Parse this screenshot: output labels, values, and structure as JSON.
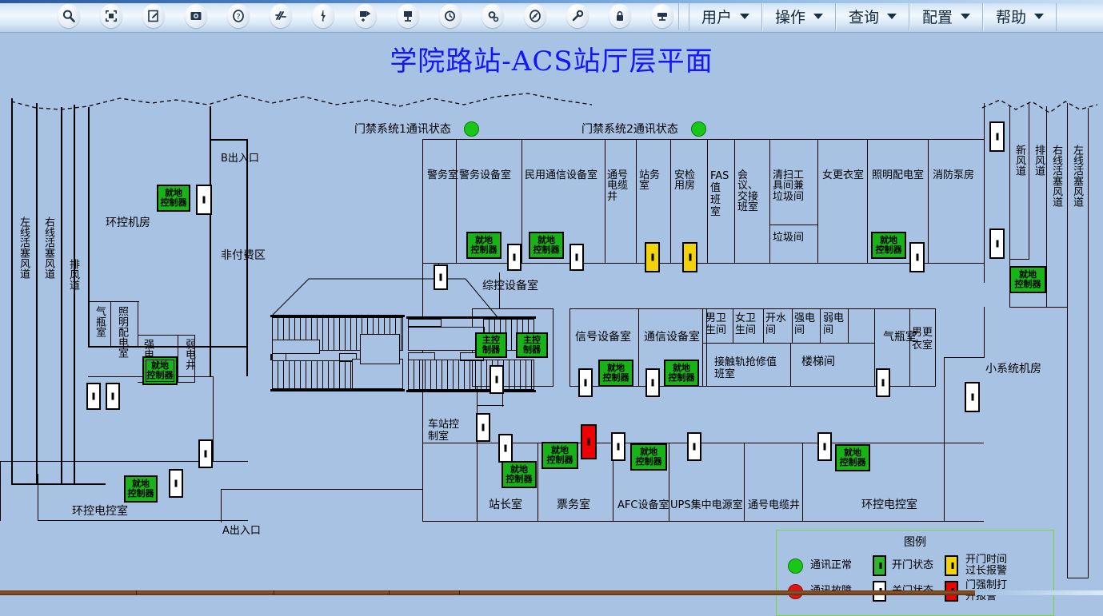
{
  "toolbar": {
    "icons": [
      {
        "name": "search-icon",
        "glyph": "search"
      },
      {
        "name": "fit-screen-icon",
        "glyph": "fit"
      },
      {
        "name": "edit-icon",
        "glyph": "edit"
      },
      {
        "name": "camera-icon",
        "glyph": "camera"
      },
      {
        "name": "help-circle-icon",
        "glyph": "question"
      },
      {
        "name": "link-broken-icon",
        "glyph": "break"
      },
      {
        "name": "lightning-icon",
        "glyph": "bolt"
      },
      {
        "name": "move-device-icon",
        "glyph": "movedev"
      },
      {
        "name": "device-icon",
        "glyph": "device"
      },
      {
        "name": "history-clock-icon",
        "glyph": "history"
      },
      {
        "name": "settings-gear-icon",
        "glyph": "gear"
      },
      {
        "name": "clock-alert-icon",
        "glyph": "clockalert"
      },
      {
        "name": "wrench-icon",
        "glyph": "wrench"
      },
      {
        "name": "lock-icon",
        "glyph": "lock"
      },
      {
        "name": "card-reader-icon",
        "glyph": "reader"
      }
    ],
    "menus": [
      {
        "label": "用户"
      },
      {
        "label": "操作"
      },
      {
        "label": "查询"
      },
      {
        "label": "配置"
      },
      {
        "label": "帮助"
      }
    ]
  },
  "page": {
    "title": "学院路站-ACS站厅层平面",
    "title_color": "#1414ff",
    "background_color": "#a8c2e3"
  },
  "status": [
    {
      "label": "门禁系统1通讯状态",
      "state": "green"
    },
    {
      "label": "门禁系统2通讯状态",
      "state": "green"
    }
  ],
  "exits": [
    {
      "label": "B出入口"
    },
    {
      "label": "A出入口"
    }
  ],
  "zones": [
    {
      "label": "非付费区"
    }
  ],
  "rooms": [
    {
      "label": "左线活塞风道",
      "orient": "vertical"
    },
    {
      "label": "右线活塞风道",
      "orient": "vertical"
    },
    {
      "label": "排风道",
      "orient": "vertical"
    },
    {
      "label": "气瓶室",
      "orient": "vertical"
    },
    {
      "label": "照明配电室",
      "orient": "vertical"
    },
    {
      "label": "强电井",
      "orient": "vertical"
    },
    {
      "label": "弱电井",
      "orient": "vertical"
    },
    {
      "label": "环控机房",
      "orient": "horizontal"
    },
    {
      "label": "环控电控室",
      "orient": "horizontal"
    },
    {
      "label": "警务室",
      "orient": "horizontal"
    },
    {
      "label": "警务设备室",
      "orient": "horizontal"
    },
    {
      "label": "民用通信设备室",
      "orient": "horizontal"
    },
    {
      "label": "通号电缆井",
      "orient": "horizontal"
    },
    {
      "label": "站务室",
      "orient": "horizontal"
    },
    {
      "label": "安检用房",
      "orient": "horizontal"
    },
    {
      "label": "FAS值班室",
      "orient": "horizontal"
    },
    {
      "label": "会议、交接班室",
      "orient": "horizontal"
    },
    {
      "label": "清扫工具间兼垃圾间",
      "orient": "horizontal"
    },
    {
      "label": "垃圾间",
      "orient": "horizontal"
    },
    {
      "label": "女更衣室",
      "orient": "horizontal"
    },
    {
      "label": "照明配电室",
      "orient": "horizontal"
    },
    {
      "label": "消防泵房",
      "orient": "horizontal"
    },
    {
      "label": "新风道",
      "orient": "vertical"
    },
    {
      "label": "排风道",
      "orient": "vertical"
    },
    {
      "label": "右线活塞风道",
      "orient": "vertical"
    },
    {
      "label": "左线活塞风道",
      "orient": "vertical"
    },
    {
      "label": "综控设备室",
      "orient": "horizontal"
    },
    {
      "label": "信号设备室",
      "orient": "horizontal"
    },
    {
      "label": "通信设备室",
      "orient": "horizontal"
    },
    {
      "label": "男卫生间",
      "orient": "horizontal"
    },
    {
      "label": "女卫生间",
      "orient": "horizontal"
    },
    {
      "label": "开水间",
      "orient": "horizontal"
    },
    {
      "label": "强电间",
      "orient": "horizontal"
    },
    {
      "label": "弱电间",
      "orient": "horizontal"
    },
    {
      "label": "接触轨抢修值班室",
      "orient": "horizontal"
    },
    {
      "label": "楼梯间",
      "orient": "horizontal"
    },
    {
      "label": "气瓶室",
      "orient": "horizontal"
    },
    {
      "label": "男更衣室",
      "orient": "horizontal"
    },
    {
      "label": "小系统机房",
      "orient": "horizontal"
    },
    {
      "label": "车站控制室",
      "orient": "horizontal"
    },
    {
      "label": "站长室",
      "orient": "horizontal"
    },
    {
      "label": "票务室",
      "orient": "horizontal"
    },
    {
      "label": "AFC设备室",
      "orient": "horizontal"
    },
    {
      "label": "UPS集中电源室",
      "orient": "horizontal"
    },
    {
      "label": "通号电缆井",
      "orient": "horizontal"
    },
    {
      "label": "环控电控室",
      "orient": "horizontal"
    }
  ],
  "room_labels": {
    "r1": "左线活塞风道",
    "r2": "右线活塞风道",
    "r3": "排风道",
    "r4": "气瓶室",
    "r5": "照明配电室",
    "r6": "强电井",
    "r7": "弱电井",
    "r8": "环控机房",
    "r9": "环控电控室",
    "r10": "警务室",
    "r11": "警务设备室",
    "r12": "民用通信设备室",
    "r13": "通号电缆井",
    "r14": "站务室",
    "r15": "安检用房",
    "r16": "FAS值班室",
    "r17": "会议、交接班室",
    "r18": "清扫工具间兼垃圾间",
    "r19": "垃圾间",
    "r20": "女更衣室",
    "r21": "照明配电室",
    "r22": "消防泵房",
    "r23": "新风道",
    "r24": "排风道",
    "r25": "右线活塞风道",
    "r26": "左线活塞风道",
    "r27": "综控设备室",
    "r28": "信号设备室",
    "r29": "通信设备室",
    "r30": "男卫生间",
    "r31": "女卫生间",
    "r32": "开水间",
    "r33": "强电间",
    "r34": "弱电间",
    "r35": "接触轨抢修值班室",
    "r36": "楼梯间",
    "r37": "气瓶室",
    "r38": "男更衣室",
    "r39": "小系统机房",
    "r40": "车站控制室",
    "r41": "站长室",
    "r42": "票务室",
    "r43": "AFC设备室",
    "r44": "UPS集中电源室",
    "r45": "通号电缆井",
    "r46": "环控电控室",
    "exitB": "B出入口",
    "exitA": "A出入口",
    "nonpaid": "非付费区"
  },
  "controllers": {
    "local": "就地\n控制器",
    "local_l1": "就地",
    "local_l2": "控制器",
    "master_l1": "主控",
    "master_l2": "制器"
  },
  "legend": {
    "title": "图例",
    "items": [
      {
        "type": "led",
        "state": "green",
        "label": "通讯正常"
      },
      {
        "type": "door",
        "state": "open",
        "label": "开门状态"
      },
      {
        "type": "door",
        "state": "warn",
        "label": "开门时间\n过长报警"
      },
      {
        "type": "led",
        "state": "red",
        "label": "通讯故障"
      },
      {
        "type": "door",
        "state": "closed",
        "label": "关门状态"
      },
      {
        "type": "door",
        "state": "alarm",
        "label": "门强制打\n开报警"
      }
    ],
    "labels": {
      "comm_ok": "通讯正常",
      "comm_fail": "通讯故障",
      "door_open": "开门状态",
      "door_closed": "关门状态",
      "door_timeout_l1": "开门时间",
      "door_timeout_l2": "过长报警",
      "door_forced_l1": "门强制打",
      "door_forced_l2": "开报警"
    }
  },
  "colors": {
    "door_open": "#2db52d",
    "door_closed": "#ffffff",
    "door_warn": "#f2d307",
    "door_alarm": "#f00000",
    "controller": "#17b317",
    "led_green": "#19c718",
    "led_red": "#e01414",
    "legend_border": "#7ad43a"
  }
}
